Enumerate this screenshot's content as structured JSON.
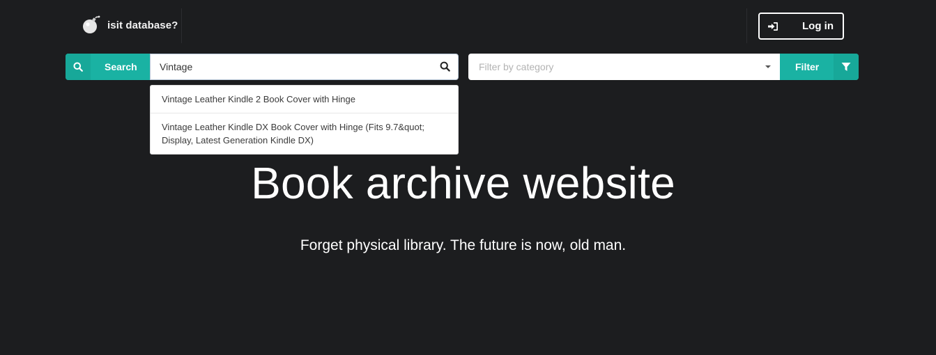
{
  "brand": {
    "name": "isit database?",
    "icon": "bomb-icon"
  },
  "header": {
    "login_label": "Log in",
    "login_icon": "sign-in-icon"
  },
  "search": {
    "button_label": "Search",
    "button_icon": "search-icon",
    "value": "Vintage",
    "input_icon": "search-icon",
    "suggestions": [
      "Vintage Leather Kindle 2 Book Cover with Hinge",
      "Vintage Leather Kindle DX Book Cover with Hinge (Fits 9.7&quot; Display, Latest Generation Kindle DX)"
    ]
  },
  "filter": {
    "placeholder": "Filter by category",
    "button_label": "Filter",
    "button_icon": "funnel-icon"
  },
  "hero": {
    "title": "Book archive website",
    "subtitle": "Forget physical library. The future is now, old man."
  },
  "colors": {
    "background": "#1c1d1f",
    "accent": "#1ab2a3",
    "accent_dark": "#17a899"
  }
}
